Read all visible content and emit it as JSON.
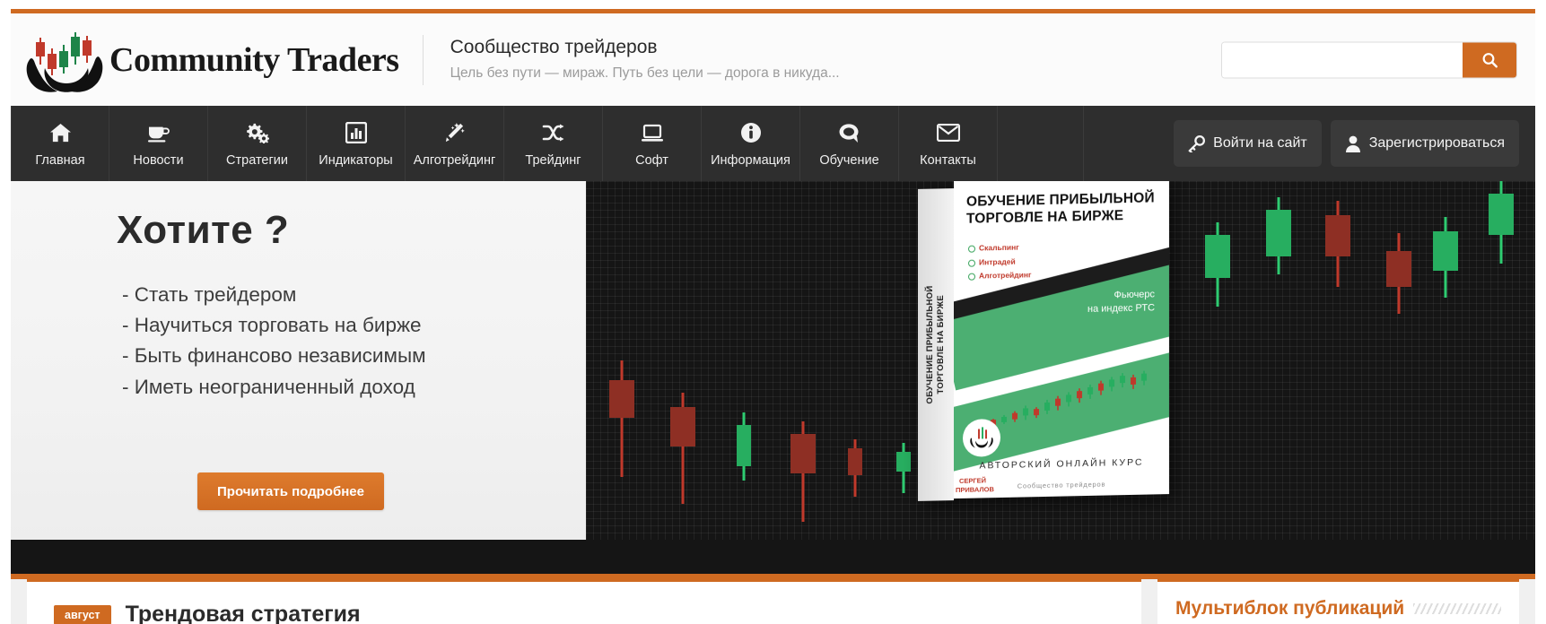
{
  "theme": {
    "accent": "#cf6a21",
    "nav_bg": "#2e2e2e",
    "dark_bg": "#151515",
    "header_bg": "#fbfbfb"
  },
  "header": {
    "logo_text": "Community Traders",
    "logo_icon": "hands-candlestick-logo-icon",
    "site_title": "Сообщество трейдеров",
    "site_tagline": "Цель без пути — мираж. Путь без цели — дорога в никуда...",
    "search": {
      "value": "",
      "placeholder": "",
      "button_icon": "search-icon"
    }
  },
  "nav": {
    "items": [
      {
        "label": "Главная",
        "icon": "home-icon"
      },
      {
        "label": "Новости",
        "icon": "coffee-cup-icon"
      },
      {
        "label": "Стратегии",
        "icon": "gears-icon"
      },
      {
        "label": "Индикаторы",
        "icon": "bar-chart-icon"
      },
      {
        "label": "Алготрейдинг",
        "icon": "magic-wand-icon"
      },
      {
        "label": "Трейдинг",
        "icon": "shuffle-icon"
      },
      {
        "label": "Софт",
        "icon": "laptop-icon"
      },
      {
        "label": "Информация",
        "icon": "info-circle-icon"
      },
      {
        "label": "Обучение",
        "icon": "comment-icon"
      },
      {
        "label": "Контакты",
        "icon": "envelope-icon"
      }
    ],
    "auth": [
      {
        "label": "Войти на сайт",
        "icon": "key-icon"
      },
      {
        "label": "Зарегистрироваться",
        "icon": "user-icon"
      }
    ]
  },
  "hero": {
    "title": "Хотите ?",
    "bullets": [
      "- Стать трейдером",
      "- Научиться торговать на бирже",
      "- Быть финансово независимым",
      "- Иметь неограниченный доход"
    ],
    "cta_label": "Прочитать подробнее",
    "product_box": {
      "spine_text": "ОБУЧЕНИЕ ПРИБЫЛЬНОЙ\nТОРГОВЛЕ НА БИРЖЕ",
      "heading": "ОБУЧЕНИЕ ПРИБЫЛЬНОЙ ТОРГОВЛЕ НА БИРЖЕ",
      "bullets": [
        "Скальпинг",
        "Интрадей",
        "Алготрейдинг"
      ],
      "subtitle": "Фьючерс\nна индекс РТС",
      "footer": "АВТОРСКИЙ ОНЛАЙН КУРС",
      "footer_small": "Сообщество трейдеров",
      "author": "СЕРГЕЙ ПРИВАЛОВ"
    }
  },
  "content": {
    "post": {
      "date_badge": "август",
      "title": "Трендовая стратегия"
    },
    "sidebar": {
      "title": "Мультиблок публикаций"
    }
  }
}
